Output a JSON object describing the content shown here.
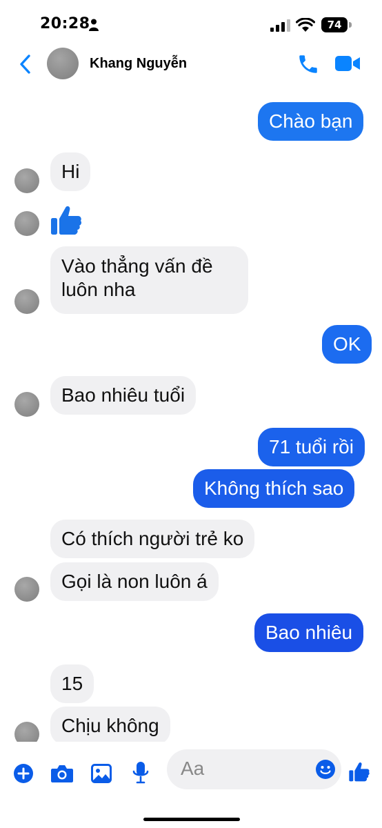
{
  "status_bar": {
    "time": "20:28",
    "battery": "74"
  },
  "header": {
    "contact_name": "Khang Nguyễn"
  },
  "colors": {
    "accent": "#0a84ff",
    "bubble_in": "#f0f0f2",
    "bubble_out_top": "#1d76f0",
    "bubble_out_bottom": "#1a4fe6"
  },
  "messages": [
    {
      "text": "Chào bạn",
      "side": "outgoing"
    },
    {
      "text": "Hi",
      "side": "incoming"
    },
    {
      "text": "thumbs-up-icon",
      "side": "incoming"
    },
    {
      "text": "Vào thẳng vấn đề",
      "text2": "luôn nha",
      "side": "incoming"
    },
    {
      "text": "OK",
      "side": "outgoing"
    },
    {
      "text": "Bao nhiêu tuổi",
      "side": "incoming"
    },
    {
      "text": "71 tuổi rồi",
      "side": "outgoing"
    },
    {
      "text": "Không thích sao",
      "side": "outgoing"
    },
    {
      "text": "Có thích người trẻ ko",
      "side": "incoming"
    },
    {
      "text": "Gọi là non luôn á",
      "side": "incoming"
    },
    {
      "text": "Bao nhiêu",
      "side": "outgoing"
    },
    {
      "text": "15",
      "side": "incoming"
    },
    {
      "text": "Chịu không",
      "side": "incoming"
    }
  ],
  "composer": {
    "placeholder": "Aa"
  },
  "icons": [
    "back-chevron-icon",
    "phone-icon",
    "video-camera-icon",
    "plus-icon",
    "camera-icon",
    "image-icon",
    "microphone-icon",
    "emoji-icon",
    "thumbs-up-icon"
  ]
}
